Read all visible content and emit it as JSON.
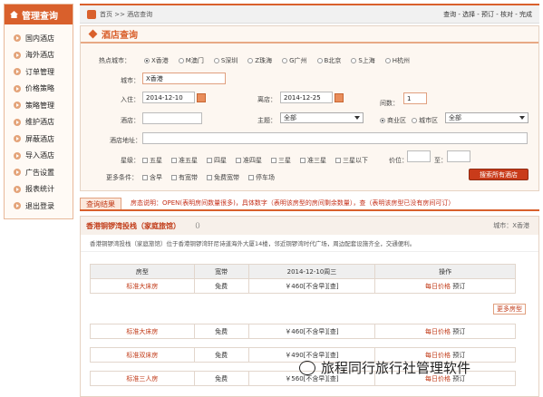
{
  "sidebar": {
    "title": "管理查询",
    "items": [
      "国内酒店",
      "海外酒店",
      "订单管理",
      "价格策略",
      "策略管理",
      "维护酒店",
      "屏蔽酒店",
      "导入酒店",
      "广告设置",
      "报表统计",
      "退出登录"
    ]
  },
  "topbar": {
    "crumb": "首页 >> 酒店查询",
    "steps": "查询 - 选择 - 预订 - 核对 - 完成"
  },
  "search": {
    "title": "酒店查询",
    "hot_city_label": "热点城市：",
    "hot_cities": [
      "X香港",
      "M澳门",
      "S深圳",
      "Z珠海",
      "G广州",
      "B北京",
      "S上海",
      "H杭州"
    ],
    "city_label": "城市：",
    "city_value": "X香港",
    "checkin_label": "入住：",
    "checkin_value": "2014-12-10",
    "checkout_label": "离店：",
    "checkout_value": "2014-12-25",
    "nights_label": "间数：",
    "nights_value": "1",
    "hotel_label": "酒店：",
    "theme_label": "主题：",
    "theme_value": "全部",
    "area_options": [
      "商业区",
      "城市区"
    ],
    "area_value": "全部",
    "address_label": "酒店地址：",
    "star_label": "星级：",
    "stars": [
      "五星",
      "准五星",
      "四星",
      "准四星",
      "三星",
      "准三星",
      "三星以下"
    ],
    "price_label": "价位：",
    "price_to": "至：",
    "more_label": "更多条件：",
    "more_options": [
      "含早",
      "有宽带",
      "免费宽带",
      "停车场"
    ],
    "search_button": "搜索所有酒店"
  },
  "results": {
    "tab": "查询结果",
    "note": "房态说明：OPEN(表明房间数量很多)，具体数字（表明该房型的房间剩余数量），查（表明该房型已没有房间可订）",
    "hotel_name": "香港铜锣湾投栈（家庭旅馆）",
    "hotel_paren": "（）",
    "city_text": "城市：X香港",
    "description": "香港铜锣湾投栈（家庭旅馆）位于香港铜锣湾轩尼诗道海外大厦14楼，邻近铜锣湾时代广场，周边配套设施齐全，交通便利。",
    "headers": [
      "房型",
      "宽带",
      "2014-12-10周三",
      "操作"
    ],
    "rows": [
      {
        "room": "标准大床房",
        "net": "免费",
        "price": "￥460[不含早][查]",
        "daily": "每日价格",
        "book": "预订"
      },
      {
        "room": "标准大床房",
        "net": "免费",
        "price": "￥460[不含早][查]",
        "daily": "每日价格",
        "book": "预订"
      },
      {
        "room": "标准双床房",
        "net": "免费",
        "price": "￥490[不含早][查]",
        "daily": "每日价格",
        "book": "预订"
      },
      {
        "room": "标准三人房",
        "net": "免费",
        "price": "￥560[不含早][查]",
        "daily": "每日价格",
        "book": "预订"
      }
    ],
    "more_button": "更多房型"
  },
  "watermark": "旅程同行旅行社管理软件",
  "colors": {
    "accent": "#d9602c",
    "link_red": "#c13b18"
  }
}
